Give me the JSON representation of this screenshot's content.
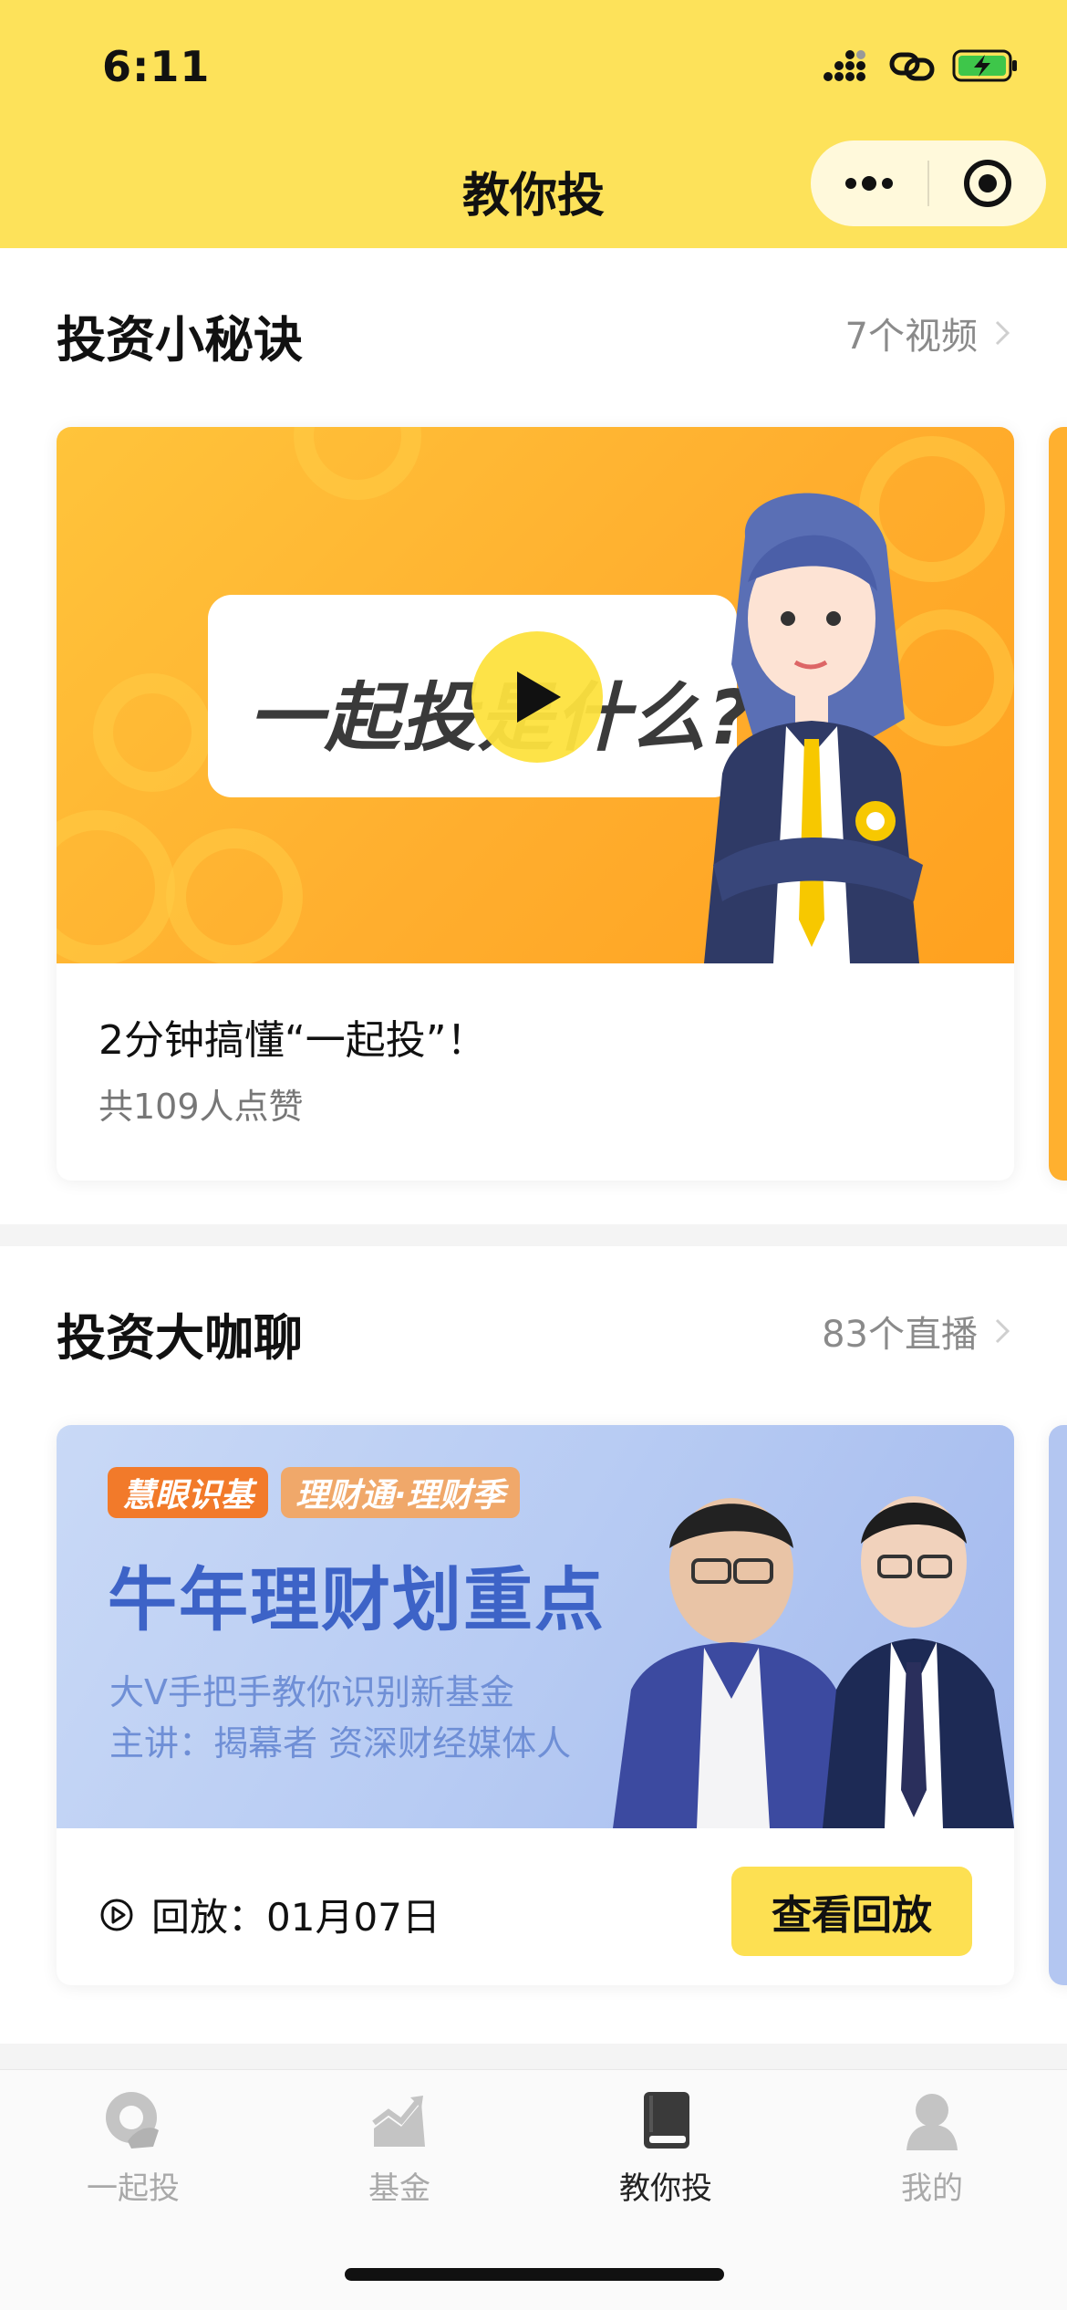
{
  "status_bar": {
    "time": "6:11"
  },
  "nav": {
    "title": "教你投"
  },
  "section_tips": {
    "title": "投资小秘诀",
    "more": "7个视频",
    "card": {
      "thumb_text": "一起投是什么?",
      "title": "2分钟搞懂“一起投”！",
      "likes": "共109人点赞"
    }
  },
  "section_live": {
    "title": "投资大咖聊",
    "more": "83个直播",
    "card": {
      "tag1": "慧眼识基",
      "tag2": "理财通·理财季",
      "headline": "牛年理财划重点",
      "line1": "大V手把手教你识别新基金",
      "line2": "主讲：揭幕者 资深财经媒体人",
      "replay_label": "回放：01月07日",
      "replay_button": "查看回放"
    }
  },
  "tabbar": {
    "items": [
      {
        "label": "一起投",
        "icon": "coin-hand-icon",
        "active": false
      },
      {
        "label": "基金",
        "icon": "chart-up-icon",
        "active": false
      },
      {
        "label": "教你投",
        "icon": "book-icon",
        "active": true
      },
      {
        "label": "我的",
        "icon": "user-icon",
        "active": false
      }
    ]
  },
  "colors": {
    "brand_yellow": "#fde25a",
    "text_primary": "#111111",
    "text_secondary": "#8a8a8a"
  }
}
